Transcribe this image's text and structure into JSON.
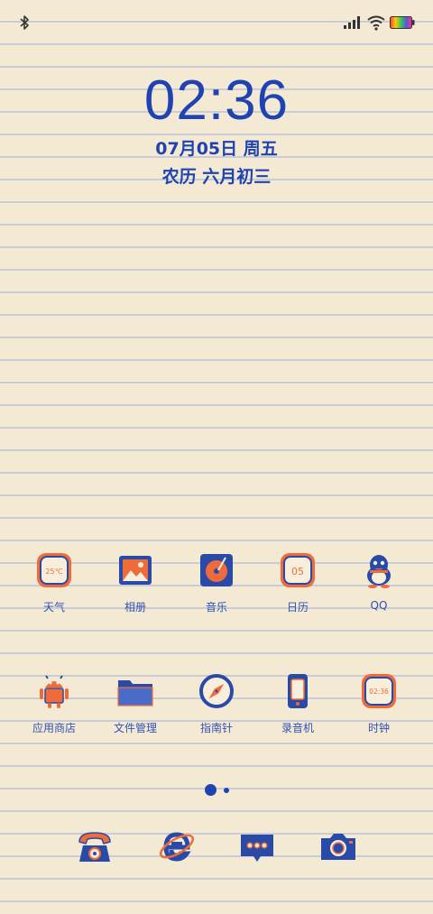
{
  "status_bar": {
    "bluetooth": "bluetooth-icon",
    "signal": "signal-icon",
    "wifi": "wifi-icon",
    "battery": "battery-icon"
  },
  "lockscreen": {
    "time": "02:36",
    "date": "07月05日 周五",
    "lunar": "农历 六月初三"
  },
  "apps_row1": [
    {
      "label": "天气",
      "icon": "weather-icon",
      "icon_text": "25℃"
    },
    {
      "label": "相册",
      "icon": "gallery-icon"
    },
    {
      "label": "音乐",
      "icon": "music-icon"
    },
    {
      "label": "日历",
      "icon": "calendar-icon",
      "icon_text": "05"
    },
    {
      "label": "QQ",
      "icon": "qq-penguin-icon"
    }
  ],
  "apps_row2": [
    {
      "label": "应用商店",
      "icon": "android-store-icon"
    },
    {
      "label": "文件管理",
      "icon": "folder-icon"
    },
    {
      "label": "指南针",
      "icon": "compass-icon"
    },
    {
      "label": "录音机",
      "icon": "recorder-icon"
    },
    {
      "label": "时钟",
      "icon": "clock-icon",
      "icon_text": "02:36"
    }
  ],
  "pages": {
    "count": 2,
    "active": 1
  },
  "dock": [
    {
      "icon": "phone-icon"
    },
    {
      "icon": "browser-icon"
    },
    {
      "icon": "messages-icon"
    },
    {
      "icon": "camera-icon"
    }
  ],
  "colors": {
    "background": "#f4ead3",
    "ruled_line": "#c9ccd6",
    "accent_blue": "#1f43b0",
    "accent_orange": "#f06b3a"
  }
}
